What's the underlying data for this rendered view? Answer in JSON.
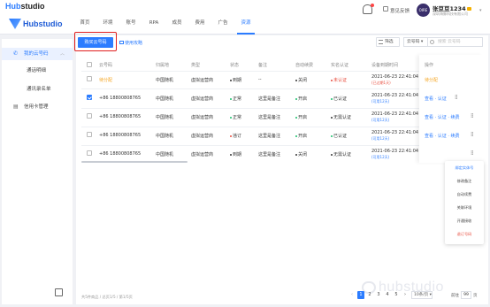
{
  "app": {
    "title_prefix": "Hub",
    "title_suffix": "studio",
    "logo_text": "Hubstudio"
  },
  "nav": [
    {
      "label": "首页",
      "active": false
    },
    {
      "label": "环境",
      "active": false
    },
    {
      "label": "账号",
      "active": false
    },
    {
      "label": "RPA",
      "active": false
    },
    {
      "label": "成员",
      "active": false
    },
    {
      "label": "费用",
      "active": false
    },
    {
      "label": "广告",
      "active": false
    },
    {
      "label": "资源",
      "active": true
    }
  ],
  "header": {
    "feedback": "意见反馈",
    "user_name": "张豆豆1234",
    "user_company": "深圳海豚科技有限公司",
    "avatar_text": "OIRE"
  },
  "sidebar": {
    "group": "我的云号码",
    "subitems": [
      "通话明细",
      "通讯录名单"
    ],
    "credit": "信用卡管理"
  },
  "toolbar": {
    "buy": "购买云号码",
    "guide": "使用攻略",
    "filter": "筛选",
    "select": "云号码",
    "search_placeholder": "搜索 云号码"
  },
  "table": {
    "headers": [
      "云号码",
      "归属地",
      "类型",
      "状态",
      "备注",
      "自动续费",
      "实名认证",
      "设备到期时间",
      "操作"
    ],
    "rows": [
      {
        "number": "待分配",
        "location": "中国随机",
        "type": "虚拟运营商",
        "status": "到期",
        "remark": "--",
        "auto": "关闭",
        "verify": "未认证",
        "expire": "2021-06-23 22:41:04",
        "expire_note": "(已过期1天)",
        "ops": "待分配",
        "checked": false
      },
      {
        "number": "+86 18800808765",
        "location": "中国随机",
        "type": "虚拟运营商",
        "status": "正常",
        "remark": "这里是备注",
        "auto": "开启",
        "verify": "已认证",
        "expire": "2021-06-23 22:41:04",
        "expire_note": "(可用12天)",
        "ops": "查看 · 认证",
        "checked": true
      },
      {
        "number": "+86 18800808765",
        "location": "中国随机",
        "type": "虚拟运营商",
        "status": "正常",
        "remark": "这里是备注",
        "auto": "开启",
        "verify": "无需认证",
        "expire": "2021-06-23 22:41:04",
        "expire_note": "(可用12天)",
        "ops": "查看 · 认证 · 续费",
        "checked": false
      },
      {
        "number": "+86 18800808765",
        "location": "中国随机",
        "type": "虚拟运营商",
        "status": "违订",
        "remark": "这里是备注",
        "auto": "开启",
        "verify": "已认证",
        "expire": "2021-06-23 22:41:04",
        "expire_note": "(可用12天)",
        "ops": "查看 · 认证 · 续费",
        "checked": false
      },
      {
        "number": "+86 18800808765",
        "location": "中国随机",
        "type": "虚拟运营商",
        "status": "到期",
        "remark": "这里是备注",
        "auto": "关闭",
        "verify": "无需认证",
        "expire": "2021-06-23 22:41:04",
        "expire_note": "(可用12天)",
        "ops": "",
        "checked": false
      }
    ]
  },
  "dropdown": [
    "绑定实体号",
    "修改备注",
    "自动续费",
    "关联环境",
    "开通接收",
    "退订号码"
  ],
  "footer": {
    "text": "共5件商品 / 总页1/5 / 第1/5页",
    "pages": [
      "1",
      "2",
      "3",
      "4",
      "5"
    ],
    "page_size": "10条/页",
    "jump_prefix": "前往",
    "jump_value": "99",
    "jump_suffix": "页"
  },
  "watermark": "hubstudio"
}
